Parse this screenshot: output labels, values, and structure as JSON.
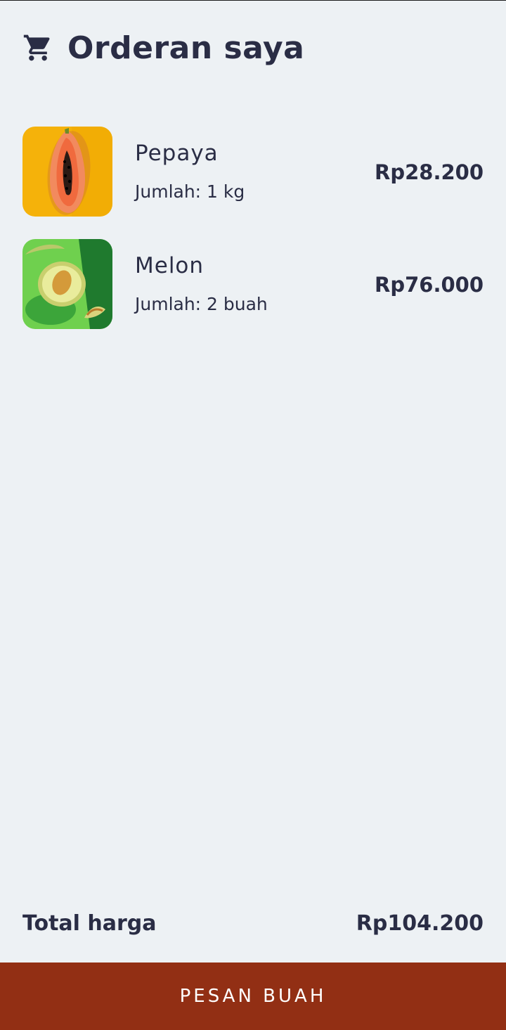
{
  "header": {
    "icon": "cart-icon",
    "title": "Orderan saya"
  },
  "orders": [
    {
      "image": "papaya-image",
      "name": "Pepaya",
      "quantity": "Jumlah: 1 kg",
      "price": "Rp28.200"
    },
    {
      "image": "melon-image",
      "name": "Melon",
      "quantity": "Jumlah: 2 buah",
      "price": "Rp76.000"
    }
  ],
  "summary": {
    "total_label": "Total harga",
    "total_value": "Rp104.200"
  },
  "action": {
    "button_label": "PESAN BUAH"
  },
  "colors": {
    "background": "#edf1f4",
    "text": "#2a2d45",
    "button": "#922f14"
  }
}
